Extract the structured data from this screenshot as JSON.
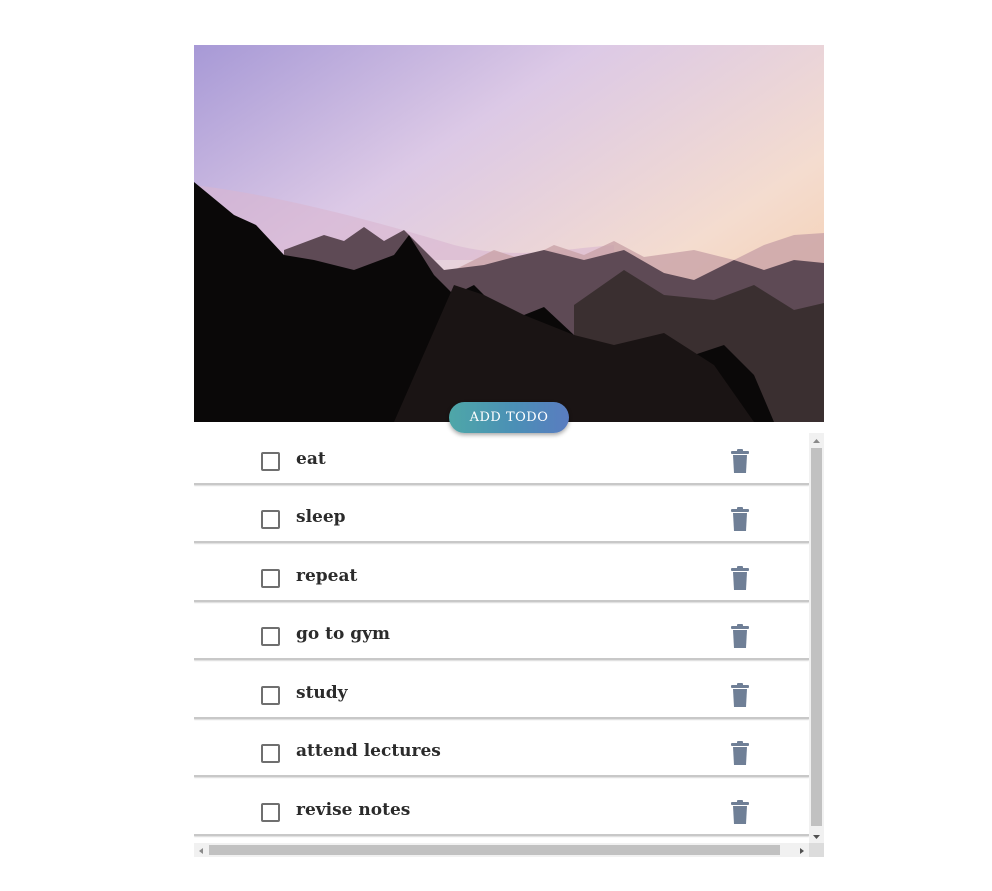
{
  "header": {
    "add_button_label": "ADD TODO",
    "image": "mountain-sunset-landscape"
  },
  "todos": [
    {
      "label": "eat",
      "checked": false
    },
    {
      "label": "sleep",
      "checked": false
    },
    {
      "label": "repeat",
      "checked": false
    },
    {
      "label": "go to gym",
      "checked": false
    },
    {
      "label": "study",
      "checked": false
    },
    {
      "label": "attend lectures",
      "checked": false
    },
    {
      "label": "revise notes",
      "checked": false
    }
  ],
  "icons": {
    "checkbox": "checkbox-icon",
    "delete": "trash-icon"
  },
  "colors": {
    "button_gradient_start": "#4ea7a8",
    "button_gradient_end": "#5a7cc0",
    "trash": "#6f7f96",
    "text": "#2b2b2b"
  }
}
